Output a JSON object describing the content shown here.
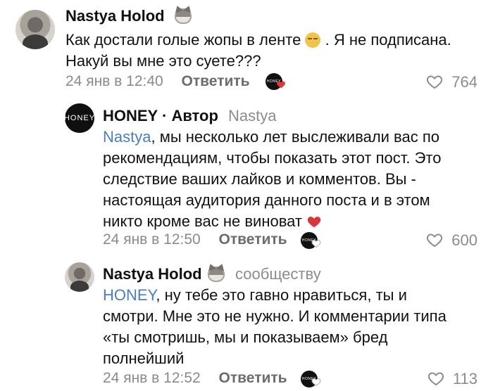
{
  "comments": [
    {
      "name": "Nastya Holod",
      "text1": "Как достали голые жопы в ленте",
      "text1b": ". Я не подписана.",
      "text2": "Накуй вы мне это суете???",
      "date": "24 янв в 12:40",
      "reply": "Ответить",
      "likes": "764",
      "reaction_logo": "HONEY",
      "emoji_icon": "unamused-face-icon"
    },
    {
      "name": "HONEY",
      "author": "· Автор",
      "to": "Nastya",
      "mention": "Nastya",
      "text_lines": [
        ", мы несколько лет выслеживали вас по",
        "рекомендациям, чтобы показать этот пост. Это",
        "следствие ваших лайков и комментов. Вы -",
        "настоящая аудитория данного поста и в этом",
        "никто кроме вас не виноват"
      ],
      "date": "24 янв в 12:50",
      "reply": "Ответить",
      "likes": "600",
      "reaction_logo": "HONEY",
      "emoji_icon": "red-heart-icon"
    },
    {
      "name": "Nastya Holod",
      "to": "сообществу",
      "mention": "HONEY",
      "text_lines": [
        ", ну тебе это гавно нравиться, ты и",
        "смотри. Мне это не нужно. И комментарии типа",
        "«ты смотришь, мы и показываем» бред",
        "полнейший"
      ],
      "date": "24 янв в 12:52",
      "reply": "Ответить",
      "likes": "113",
      "reaction_logo": "HONEY"
    }
  ],
  "colors": {
    "link": "#4a7fbe",
    "meta": "#8c8c8c",
    "text": "#111111"
  }
}
